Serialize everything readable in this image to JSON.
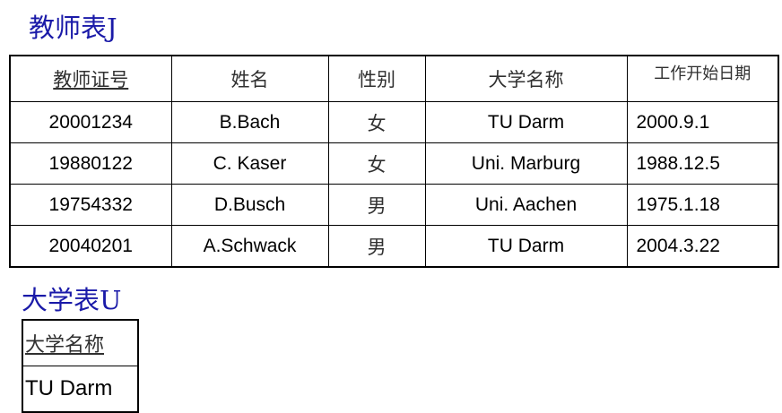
{
  "teacher_table": {
    "title": "教师表J",
    "headers": [
      "教师证号",
      "姓名",
      "性别",
      "大学名称",
      "工作开始日期"
    ],
    "rows": [
      [
        "20001234",
        "B.Bach",
        "女",
        "TU Darm",
        "2000.9.1"
      ],
      [
        "19880122",
        "C. Kaser",
        "女",
        "Uni. Marburg",
        "1988.12.5"
      ],
      [
        "19754332",
        "D.Busch",
        "男",
        "Uni. Aachen",
        "1975.1.18"
      ],
      [
        "20040201",
        "A.Schwack",
        "男",
        "TU Darm",
        "2004.3.22"
      ]
    ]
  },
  "university_table": {
    "title": "大学表U",
    "header": "大学名称",
    "rows": [
      [
        "TU Darm"
      ]
    ]
  },
  "colors": {
    "title": "#1a1aa8",
    "border": "#000000"
  }
}
